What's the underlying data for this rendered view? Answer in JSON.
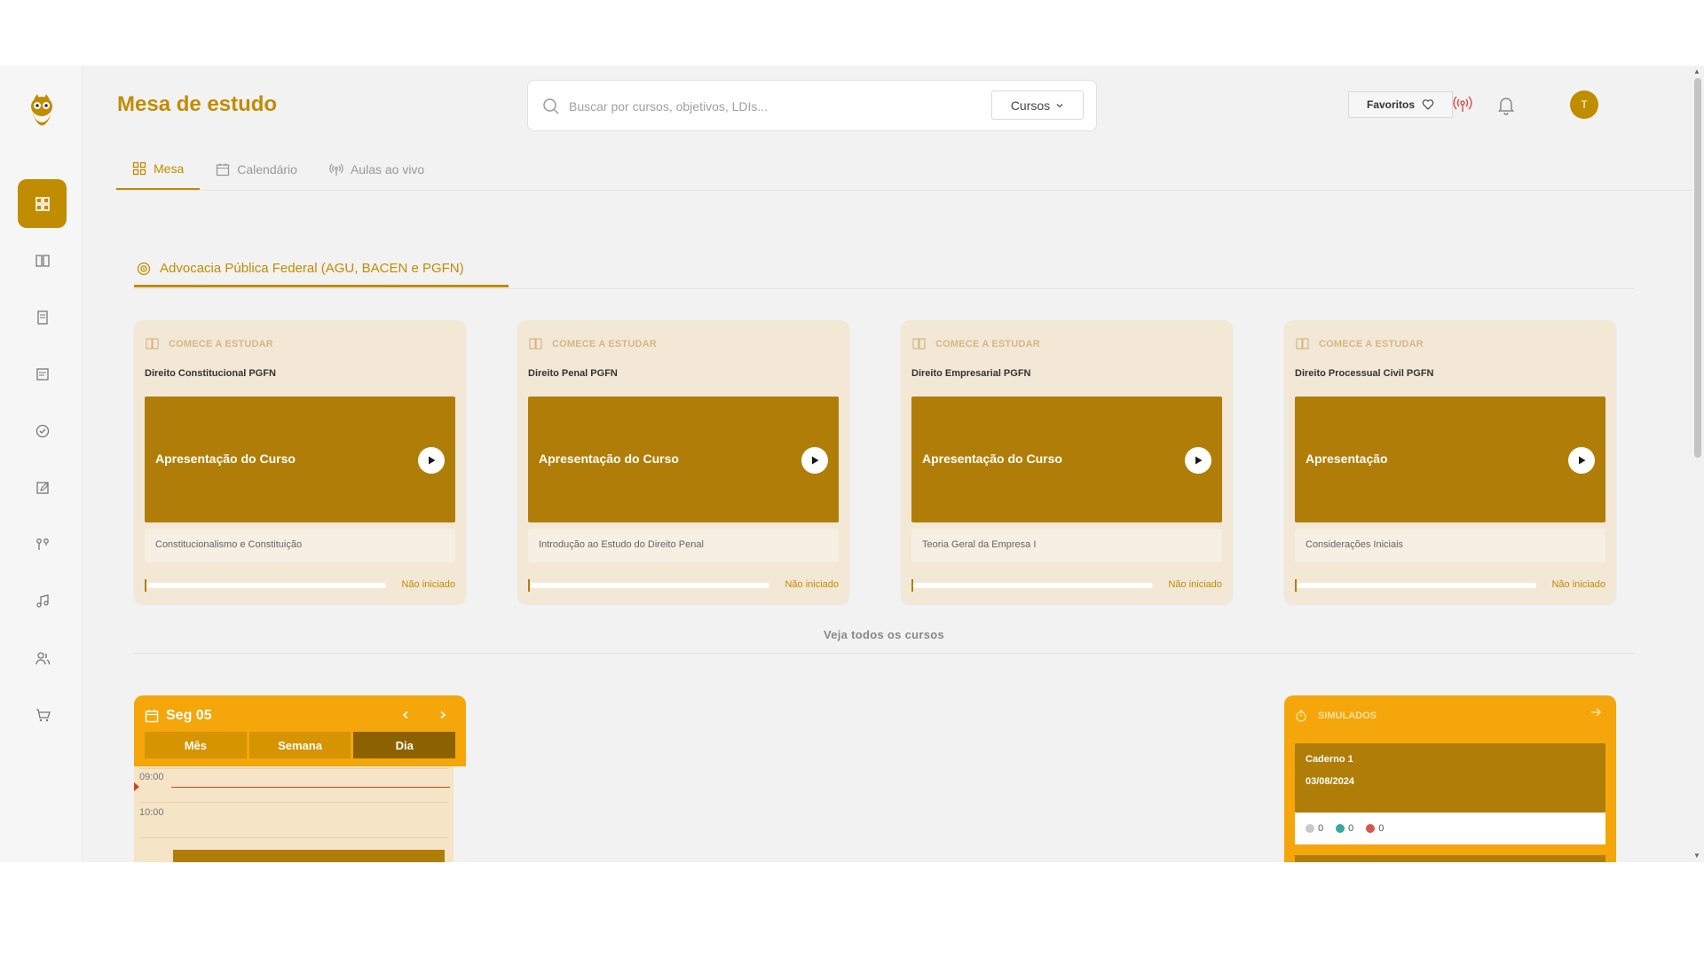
{
  "header": {
    "title": "Mesa de estudo",
    "search_placeholder": "Buscar por cursos, objetivos, LDIs...",
    "search_scope": "Cursos",
    "favorites_label": "Favoritos",
    "avatar_initial": "T"
  },
  "tabs": [
    {
      "label": "Mesa",
      "icon": "dashboard-icon",
      "active": true
    },
    {
      "label": "Calendário",
      "icon": "calendar-icon",
      "active": false
    },
    {
      "label": "Aulas ao vivo",
      "icon": "broadcast-icon",
      "active": false
    }
  ],
  "sidebar": {
    "items": [
      {
        "icon": "dashboard-icon",
        "active": true
      },
      {
        "icon": "book-open-icon"
      },
      {
        "icon": "notebook-icon"
      },
      {
        "icon": "document-icon"
      },
      {
        "icon": "check-circle-icon"
      },
      {
        "icon": "edit-icon"
      },
      {
        "icon": "route-icon"
      },
      {
        "icon": "music-note-icon"
      },
      {
        "icon": "users-icon"
      },
      {
        "icon": "cart-icon"
      }
    ]
  },
  "section": {
    "label": "Advocacia Pública Federal (AGU, BACEN e PGFN)"
  },
  "courses": [
    {
      "eyebrow": "COMECE A ESTUDAR",
      "title": "Direito Constitucional PGFN",
      "video": "Apresentação do Curso",
      "lesson": "Constitucionalismo e Constituição",
      "status": "Não iniciado",
      "progress": 0
    },
    {
      "eyebrow": "COMECE A ESTUDAR",
      "title": "Direito Penal PGFN",
      "video": "Apresentação do Curso",
      "lesson": "Introdução ao Estudo do Direito Penal",
      "status": "Não iniciado",
      "progress": 0
    },
    {
      "eyebrow": "COMECE A ESTUDAR",
      "title": "Direito Empresarial PGFN",
      "video": "Apresentação do Curso",
      "lesson": "Teoria Geral da Empresa I",
      "status": "Não iniciado",
      "progress": 0
    },
    {
      "eyebrow": "COMECE A ESTUDAR",
      "title": "Direito Processual Civil PGFN",
      "video": "Apresentação",
      "lesson": "Considerações Iniciais",
      "status": "Não iniciado",
      "progress": 0
    }
  ],
  "see_all": "Veja todos os cursos",
  "calendar": {
    "date": "Seg 05",
    "views": [
      "Mês",
      "Semana",
      "Dia"
    ],
    "active_view": "Dia",
    "times": [
      "09:00",
      "10:00"
    ]
  },
  "simulados": {
    "title": "SIMULADOS",
    "item": {
      "name": "Caderno 1",
      "date": "03/08/2024"
    },
    "stats": [
      {
        "value": "0",
        "color": "#c8c8c8"
      },
      {
        "value": "0",
        "color": "#3aa6a0"
      },
      {
        "value": "0",
        "color": "#d9534f"
      }
    ]
  },
  "colors": {
    "accent": "#c08c00",
    "card_bg": "#f3e8d6",
    "orange": "#f4a60a"
  }
}
